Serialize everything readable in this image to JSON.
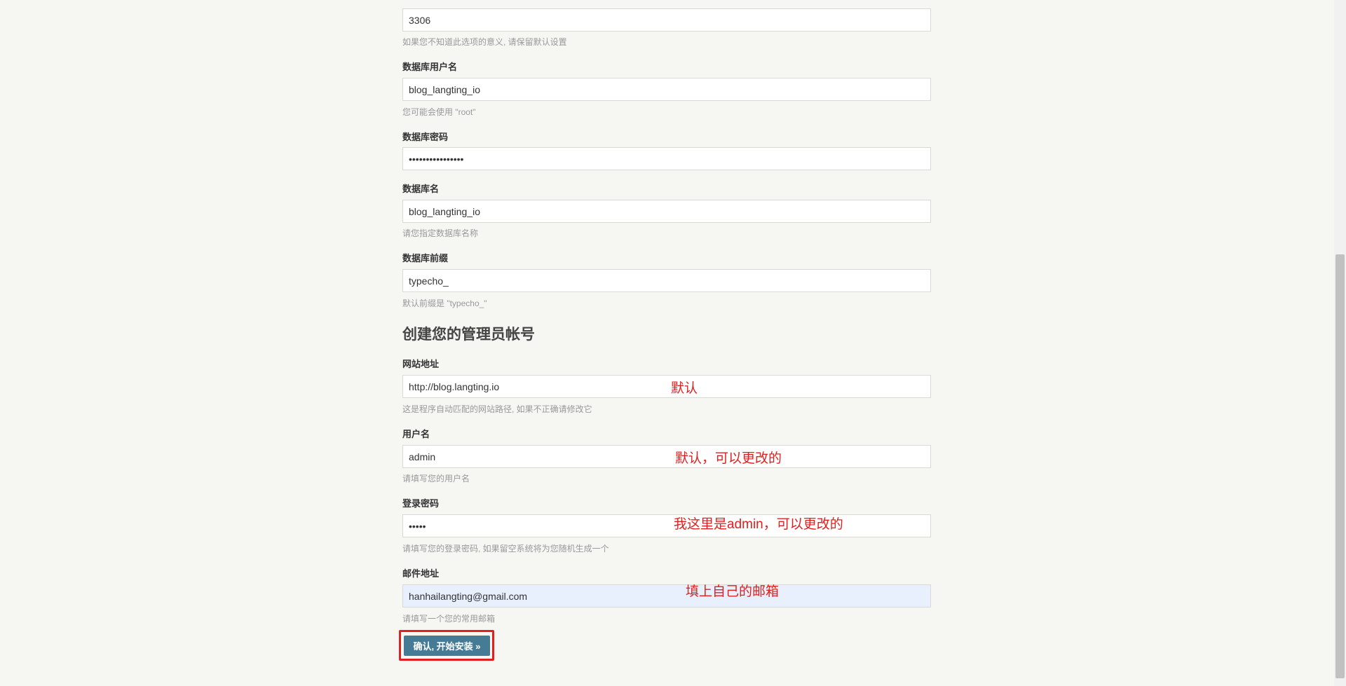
{
  "db": {
    "port_value": "3306",
    "port_help": "如果您不知道此选项的意义, 请保留默认设置",
    "user_label": "数据库用户名",
    "user_value": "blog_langting_io",
    "user_help": "您可能会使用 \"root\"",
    "password_label": "数据库密码",
    "password_value": "passwordpassword",
    "name_label": "数据库名",
    "name_value": "blog_langting_io",
    "name_help": "请您指定数据库名称",
    "prefix_label": "数据库前缀",
    "prefix_value": "typecho_",
    "prefix_help": "默认前缀是 \"typecho_\""
  },
  "admin": {
    "section_title": "创建您的管理员帐号",
    "site_label": "网站地址",
    "site_value": "http://blog.langting.io",
    "site_help": "这是程序自动匹配的网站路径, 如果不正确请修改它",
    "username_label": "用户名",
    "username_value": "admin",
    "username_help": "请填写您的用户名",
    "password_label": "登录密码",
    "password_value": "admin",
    "password_help": "请填写您的登录密码, 如果留空系统将为您随机生成一个",
    "email_label": "邮件地址",
    "email_value": "hanhailangting@gmail.com",
    "email_help": "请填写一个您的常用邮箱"
  },
  "submit_label": "确认, 开始安装 »",
  "annotations": {
    "site": "默认",
    "username": "默认，可以更改的",
    "password": "我这里是admin，可以更改的",
    "email": "填上自己的邮箱"
  },
  "colors": {
    "background": "#f6f6f3",
    "button": "#467b96",
    "annotation": "#e0201f",
    "autofill": "#e8f0fe"
  }
}
